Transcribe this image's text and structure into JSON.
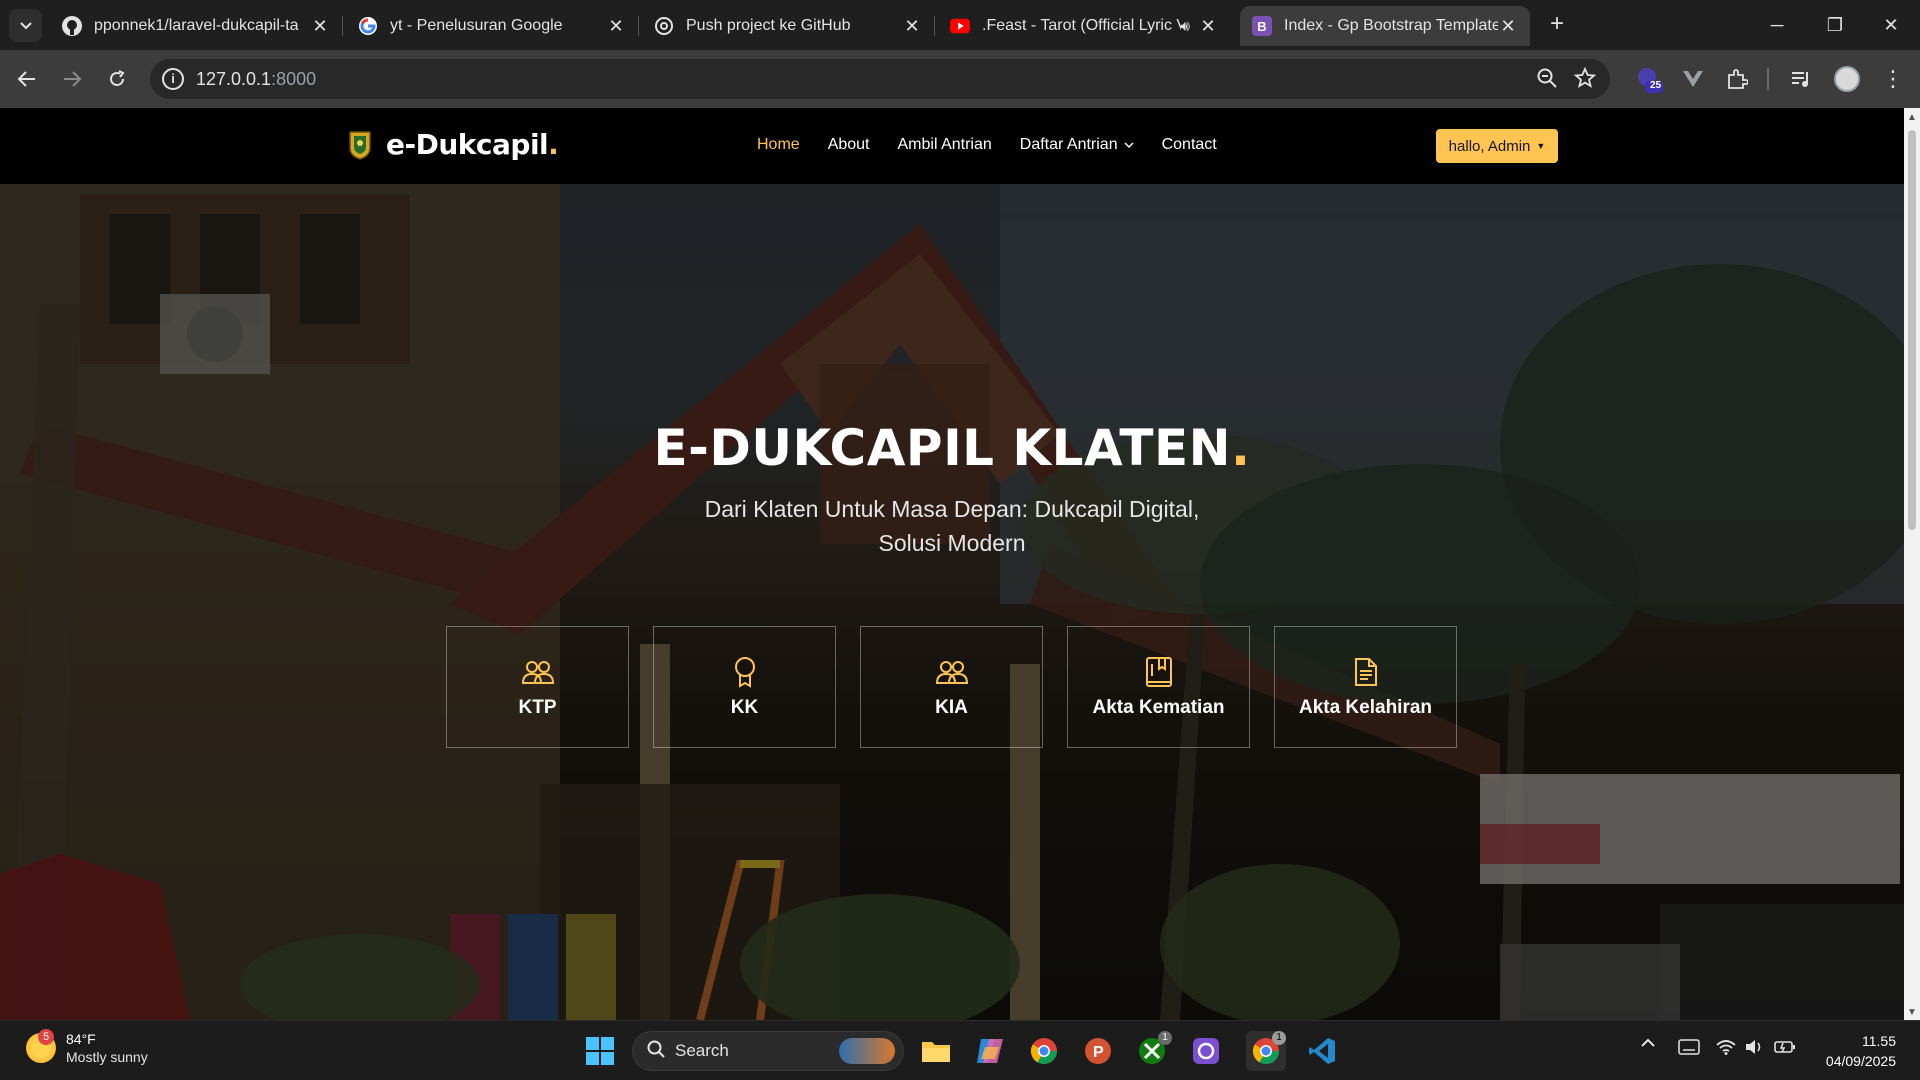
{
  "browser": {
    "tabs": [
      {
        "title": "pponnek1/laravel-dukcapil-ta",
        "icon": "github-icon"
      },
      {
        "title": "yt - Penelusuran Google",
        "icon": "google-icon"
      },
      {
        "title": "Push project ke GitHub",
        "icon": "openai-icon"
      },
      {
        "title": ".Feast - Tarot (Official Lyric V",
        "icon": "youtube-icon"
      },
      {
        "title": "Index - Gp Bootstrap Template",
        "icon": "bootstrap-icon",
        "active": true
      }
    ],
    "new_tab": "+",
    "url_host": "127.0.0.1",
    "url_port": ":8000",
    "extension_badge": "25"
  },
  "site": {
    "brand": "e-Dukcapil",
    "brand_dot": ".",
    "nav": [
      {
        "label": "Home",
        "active": true
      },
      {
        "label": "About"
      },
      {
        "label": "Ambil Antrian"
      },
      {
        "label": "Daftar Antrian",
        "dropdown": true
      },
      {
        "label": "Contact"
      }
    ],
    "user_button": "hallo, Admin",
    "accent": "#ffc451",
    "hero": {
      "title": "E-DUKCAPIL KLATEN",
      "title_dot": ".",
      "subtitle": "Dari Klaten Untuk Masa Depan: Dukcapil Digital, Solusi Modern"
    },
    "services": [
      {
        "label": "KTP",
        "icon": "people-icon"
      },
      {
        "label": "KK",
        "icon": "award-icon"
      },
      {
        "label": "KIA",
        "icon": "people-icon"
      },
      {
        "label": "Akta Kematian",
        "icon": "book-icon"
      },
      {
        "label": "Akta Kelahiran",
        "icon": "document-icon"
      }
    ]
  },
  "taskbar": {
    "weather": {
      "badge": "5",
      "temp": "84°F",
      "desc": "Mostly sunny"
    },
    "search_label": "Search",
    "time": "11.55",
    "date": "04/09/2025",
    "chrome_badge": "1"
  }
}
